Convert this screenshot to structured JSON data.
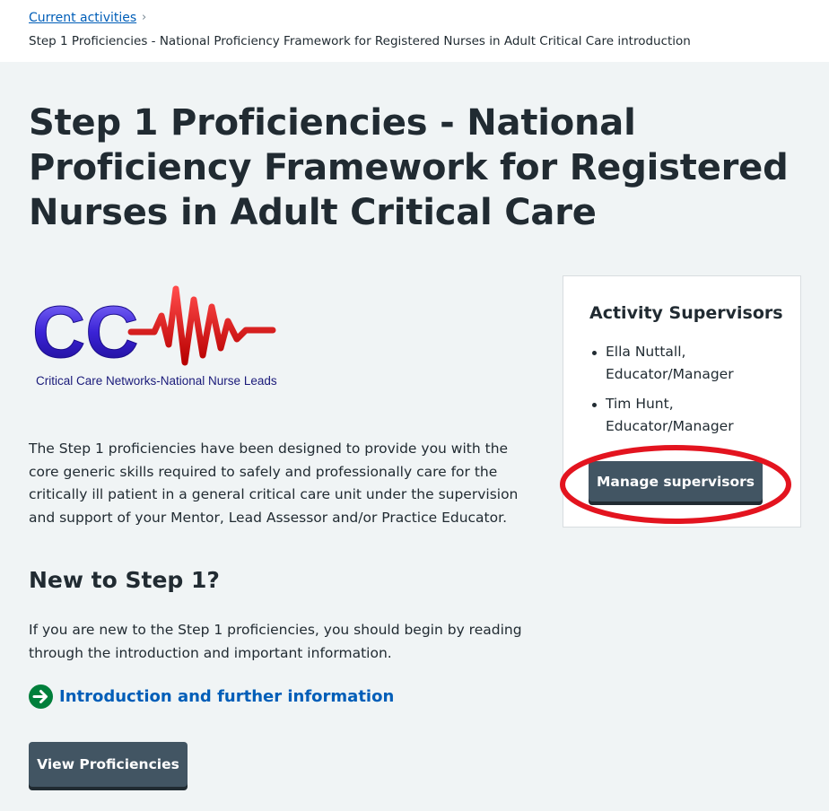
{
  "breadcrumb": {
    "parent_label": "Current activities",
    "chevron": "›",
    "current_label": "Step 1 Proficiencies - National Proficiency Framework for Registered Nurses in Adult Critical Care introduction"
  },
  "page": {
    "title": "Step 1 Proficiencies - National Proficiency Framework for Registered Nurses in Adult Critical Care",
    "intro": "The Step 1 proficiencies have been designed to provide you with the core generic skills required to safely and professionally care for the critically ill patient in a general critical care unit under the supervision and support of your Mentor, Lead Assessor and/or Practice Educator."
  },
  "logo": {
    "letters": "CC",
    "caption": "Critical Care Networks-National Nurse Leads"
  },
  "new_section": {
    "heading": "New to Step 1?",
    "text": "If you are new to the Step 1 proficiencies, you should begin by reading through the introduction and important information.",
    "link_label": "Introduction and further information"
  },
  "actions": {
    "view_label": "View Proficiencies"
  },
  "supervisors": {
    "title": "Activity Supervisors",
    "items": [
      {
        "name": "Ella Nuttall,",
        "role": "Educator/Manager"
      },
      {
        "name": "Tim Hunt,",
        "role": "Educator/Manager"
      }
    ],
    "manage_label": "Manage supervisors"
  },
  "colors": {
    "link": "#005eb8",
    "button": "#425563",
    "action_arrow": "#007f3b",
    "highlight": "#e3141f"
  }
}
